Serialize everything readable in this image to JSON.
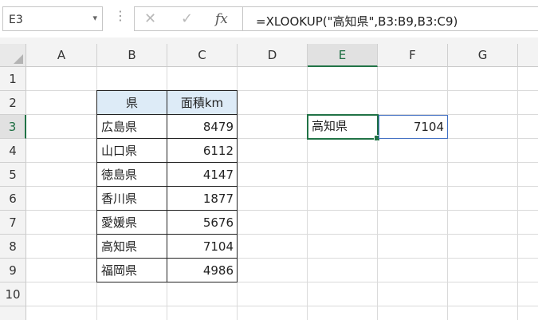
{
  "formula_bar": {
    "name_box": "E3",
    "cancel_icon": "✕",
    "enter_icon": "✓",
    "fx_label": "fx",
    "formula": "=XLOOKUP(\"高知県\",B3:B9,B3:C9)"
  },
  "columns": [
    "A",
    "B",
    "C",
    "D",
    "E",
    "F",
    "G"
  ],
  "rows": [
    "1",
    "2",
    "3",
    "4",
    "5",
    "6",
    "7",
    "8",
    "9",
    "10"
  ],
  "selected": {
    "column": "E",
    "row": "3"
  },
  "table": {
    "headers": [
      "県",
      "面積km"
    ],
    "rows": [
      [
        "広島県",
        "8479"
      ],
      [
        "山口県",
        "6112"
      ],
      [
        "徳島県",
        "4147"
      ],
      [
        "香川県",
        "1877"
      ],
      [
        "愛媛県",
        "5676"
      ],
      [
        "高知県",
        "7104"
      ],
      [
        "福岡県",
        "4986"
      ]
    ]
  },
  "lookup": {
    "key": "高知県",
    "result": "7104"
  },
  "colors": {
    "accent": "#217346",
    "header_fill": "#ddebf7",
    "result_border": "#4472c4"
  },
  "icons": [
    "dropdown-caret-icon",
    "more-options-icon",
    "cancel-icon",
    "enter-icon",
    "insert-function-icon",
    "select-all-icon"
  ]
}
